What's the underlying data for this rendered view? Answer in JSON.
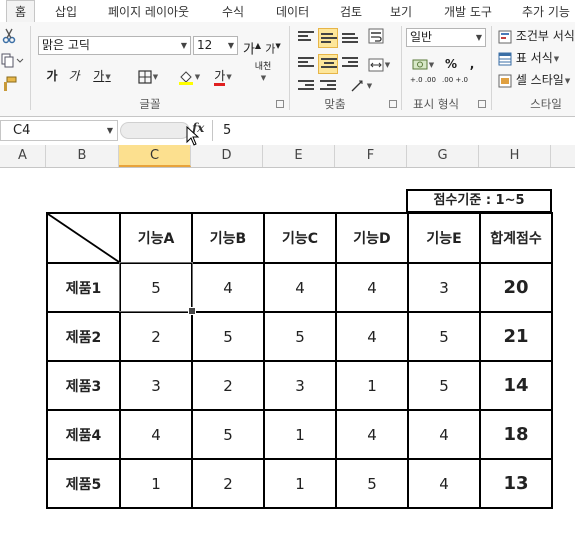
{
  "ribbon_tabs": [
    "홈",
    "삽입",
    "페이지 레이아웃",
    "수식",
    "데이터",
    "검토",
    "보기",
    "개발 도구",
    "추가 기능"
  ],
  "font": {
    "name": "맑은 고딕",
    "size": "12",
    "grow_label": "가",
    "shrink_label": "가",
    "bold_label": "가",
    "italic_label": "가",
    "underline_label": "가",
    "color_label": "가",
    "phonetic_label": "내천",
    "group_label": "글꼴"
  },
  "alignment": {
    "group_label": "맞춤"
  },
  "number": {
    "format": "일반",
    "percent": "%",
    "comma": ",",
    "inc_decimal": "+.0 .00",
    "dec_decimal": ".00 +.0",
    "group_label": "표시 형식"
  },
  "styles": {
    "conditional": "조건부 서식",
    "table_format": "표 서식",
    "cell_style": "셀 스타일",
    "group_label": "스타일"
  },
  "formula_bar": {
    "name_box": "C4",
    "fx": "fx",
    "value": "5"
  },
  "columns": [
    "A",
    "B",
    "C",
    "D",
    "E",
    "F",
    "G",
    "H"
  ],
  "selected_column": "C",
  "sheet": {
    "criteria": "점수기준 : 1~5",
    "headers": [
      "기능A",
      "기능B",
      "기능C",
      "기능D",
      "기능E",
      "합계점수"
    ],
    "rows": [
      {
        "name": "제품1",
        "scores": [
          "5",
          "4",
          "4",
          "4",
          "3"
        ],
        "total": "20"
      },
      {
        "name": "제품2",
        "scores": [
          "2",
          "5",
          "5",
          "4",
          "5"
        ],
        "total": "21"
      },
      {
        "name": "제품3",
        "scores": [
          "3",
          "2",
          "3",
          "1",
          "5"
        ],
        "total": "14"
      },
      {
        "name": "제품4",
        "scores": [
          "4",
          "5",
          "1",
          "4",
          "4"
        ],
        "total": "18"
      },
      {
        "name": "제품5",
        "scores": [
          "1",
          "2",
          "1",
          "5",
          "4"
        ],
        "total": "13"
      }
    ]
  },
  "colors": {
    "selected_header": "#fce08f",
    "active_align": "#fde69a",
    "tab_active_bg": "#f3f3f3"
  }
}
